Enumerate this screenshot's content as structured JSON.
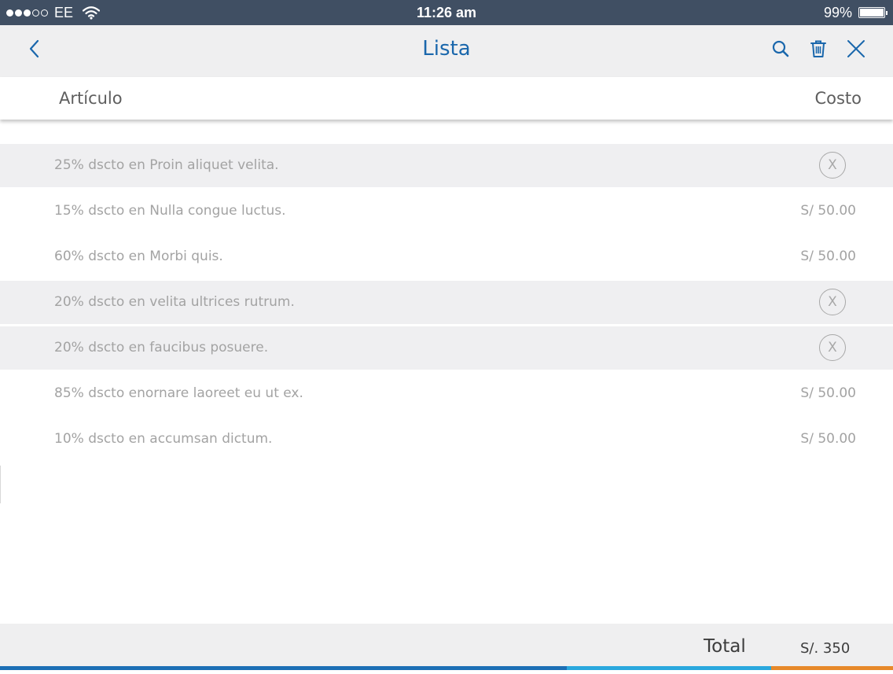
{
  "status_bar": {
    "carrier": "EE",
    "signal_full": 3,
    "signal_empty": 2,
    "time": "11:26 am",
    "battery": "99%",
    "battery_level": 0.99
  },
  "nav": {
    "title": "Lista",
    "back_icon": "chevron-left-icon",
    "search_icon": "search-icon",
    "delete_icon": "trash-icon",
    "close_icon": "close-icon"
  },
  "columns": {
    "item": "Artículo",
    "cost": "Costo"
  },
  "items": [
    {
      "label": "25% dscto en Proin aliquet velita.",
      "price": "",
      "removable": true,
      "highlighted": true
    },
    {
      "label": "15% dscto en Nulla congue luctus.",
      "price": "S/ 50.00",
      "removable": false,
      "highlighted": false
    },
    {
      "label": "60% dscto en Morbi quis.",
      "price": "S/ 50.00",
      "removable": false,
      "highlighted": false
    },
    {
      "label": "20% dscto en velita ultrices rutrum.",
      "price": "",
      "removable": true,
      "highlighted": true
    },
    {
      "label": "20% dscto en faucibus posuere.",
      "price": "",
      "removable": true,
      "highlighted": true
    },
    {
      "label": "85% dscto enornare laoreet eu ut ex.",
      "price": "S/ 50.00",
      "removable": false,
      "highlighted": false
    },
    {
      "label": "10% dscto en accumsan dictum.",
      "price": "S/ 50.00",
      "removable": false,
      "highlighted": false
    }
  ],
  "remove_label": "X",
  "footer": {
    "total_label": "Total",
    "total_value": "S/. 350"
  },
  "colors": {
    "accent": "#1a67ac",
    "status_bar": "#404f63",
    "bar_segments": [
      "#1c6fb5",
      "#2aa8de",
      "#e7892a"
    ]
  }
}
